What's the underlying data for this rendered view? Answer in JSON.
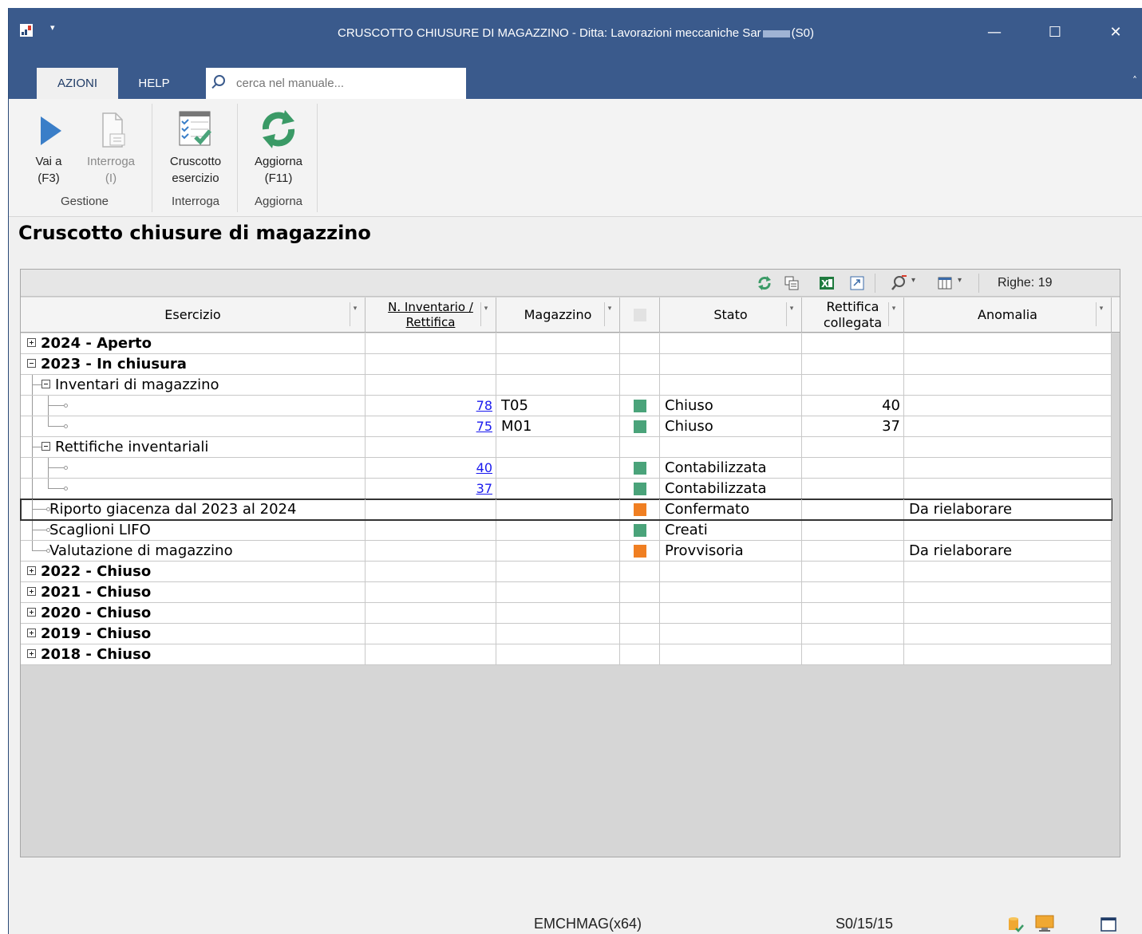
{
  "window": {
    "title_prefix": "CRUSCOTTO CHIUSURE DI MAGAZZINO - Ditta: Lavorazioni meccaniche Sar",
    "title_suffix": "(S0)",
    "minimize": "—",
    "maximize": "☐",
    "close": "✕",
    "quick_access": "▾"
  },
  "ribbon": {
    "tabs": [
      {
        "label": "AZIONI",
        "active": true
      },
      {
        "label": "HELP",
        "active": false
      }
    ],
    "search_placeholder": "cerca nel manuale...",
    "collapse": "˄",
    "buttons": {
      "vai_a": {
        "line1": "Vai a",
        "line2": "(F3)"
      },
      "interroga": {
        "line1": "Interroga",
        "line2": "(I)"
      },
      "cruscotto": {
        "line1": "Cruscotto",
        "line2": "esercizio"
      },
      "aggiorna": {
        "line1": "Aggiorna",
        "line2": "(F11)"
      }
    },
    "groups": {
      "gestione": "Gestione",
      "interroga": "Interroga",
      "aggiorna": "Aggiorna"
    }
  },
  "page_title": "Cruscotto chiusure di magazzino",
  "grid": {
    "rows_label": "Righe: 19",
    "headers": {
      "esercizio": "Esercizio",
      "inventario_line1": "N. Inventario /",
      "inventario_line2": "Rettifica",
      "magazzino": "Magazzino",
      "stato": "Stato",
      "rettifica_line1": "Rettifica",
      "rettifica_line2": "collegata",
      "anomalia": "Anomalia"
    },
    "rows": [
      {
        "kind": "year",
        "expander": "plus",
        "label": "2024 - Aperto"
      },
      {
        "kind": "year",
        "expander": "minus",
        "label": "2023 - In chiusura"
      },
      {
        "kind": "group",
        "label": "Inventari di magazzino"
      },
      {
        "kind": "leaf2",
        "last": false,
        "number": "78",
        "magazzino": "T05",
        "color": "green",
        "stato": "Chiuso",
        "rettifica": "40",
        "anomalia": ""
      },
      {
        "kind": "leaf2",
        "last": true,
        "number": "75",
        "magazzino": "M01",
        "color": "green",
        "stato": "Chiuso",
        "rettifica": "37",
        "anomalia": ""
      },
      {
        "kind": "group",
        "label": "Rettifiche inventariali"
      },
      {
        "kind": "leaf2",
        "last": false,
        "number": "40",
        "magazzino": "",
        "color": "green",
        "stato": "Contabilizzata",
        "rettifica": "",
        "anomalia": ""
      },
      {
        "kind": "leaf2",
        "last": true,
        "number": "37",
        "magazzino": "",
        "color": "green",
        "stato": "Contabilizzata",
        "rettifica": "",
        "anomalia": ""
      },
      {
        "kind": "leaf1",
        "label": "Riporto giacenza dal 2023 al 2024",
        "color": "orange",
        "stato": "Confermato",
        "anomalia": "Da rielaborare",
        "selected": true
      },
      {
        "kind": "leaf1",
        "label": "Scaglioni LIFO",
        "color": "green",
        "stato": "Creati",
        "anomalia": ""
      },
      {
        "kind": "leaf1",
        "label": "Valutazione di magazzino",
        "last": true,
        "color": "orange",
        "stato": "Provvisoria",
        "anomalia": "Da rielaborare"
      },
      {
        "kind": "year",
        "expander": "plus",
        "label": "2022 - Chiuso"
      },
      {
        "kind": "year",
        "expander": "plus",
        "label": "2021 - Chiuso"
      },
      {
        "kind": "year",
        "expander": "plus",
        "label": "2020 - Chiuso"
      },
      {
        "kind": "year",
        "expander": "plus",
        "label": "2019 - Chiuso"
      },
      {
        "kind": "year",
        "expander": "plus",
        "label": "2018 - Chiuso"
      }
    ]
  },
  "colors": {
    "green": "#4aa37a",
    "orange": "#f07f22",
    "titlebar": "#3a5a8c"
  },
  "statusbar": {
    "module": "EMCHMAG(x64)",
    "session": "S0/15/15"
  }
}
